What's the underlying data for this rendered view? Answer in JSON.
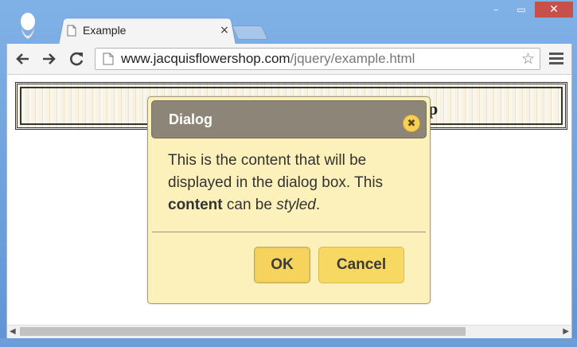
{
  "browser": {
    "tab": {
      "title": "Example",
      "close_label": "×"
    },
    "window_controls": {
      "minimize": "–",
      "maximize": "▭",
      "close": "✕"
    },
    "nav": {
      "back": "←",
      "forward": "→",
      "reload": "C"
    },
    "address": {
      "host": "www.jacquisflowershop.com",
      "path": "/jquery/example.html"
    },
    "star": "☆"
  },
  "page": {
    "banner_text": "op"
  },
  "dialog": {
    "title": "Dialog",
    "close_label": "✖",
    "content": {
      "part1": "This is the content that will be displayed in the dialog box. This ",
      "bold": "content",
      "part2": " can be ",
      "italic": "styled",
      "part3": "."
    },
    "buttons": {
      "ok": "OK",
      "cancel": "Cancel"
    }
  },
  "scrollbar": {
    "left_arrow": "◀",
    "right_arrow": "▶"
  }
}
